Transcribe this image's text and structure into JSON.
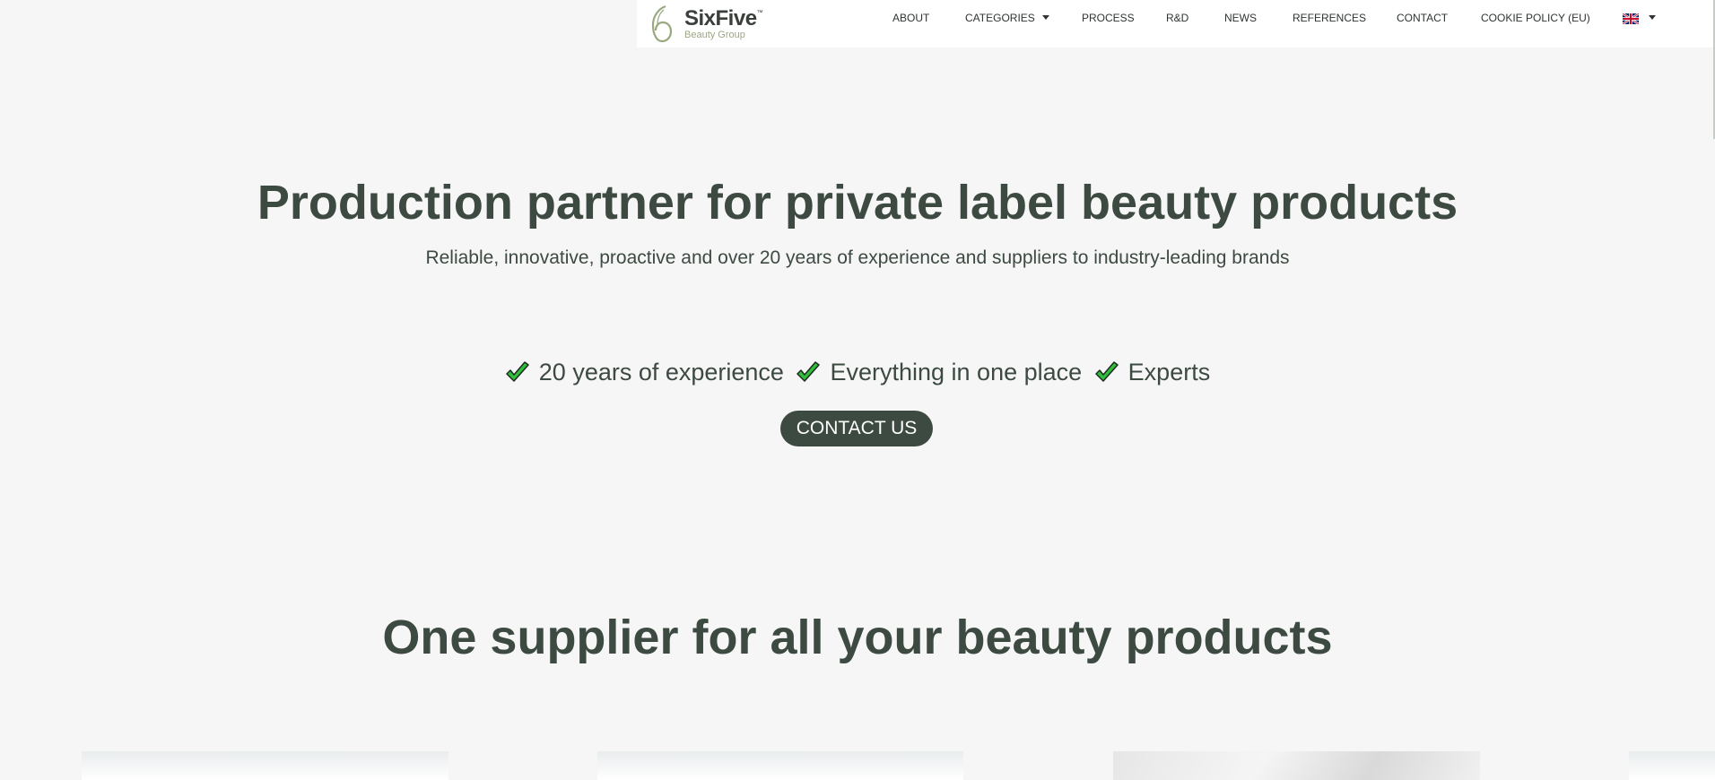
{
  "header": {
    "logo": {
      "name": "SixFive",
      "tm": "™",
      "subtitle": "Beauty Group"
    },
    "nav": [
      {
        "label": "ABOUT"
      },
      {
        "label": "CATEGORIES"
      },
      {
        "label": "PROCESS"
      },
      {
        "label": "R&D"
      },
      {
        "label": "NEWS"
      },
      {
        "label": "REFERENCES"
      },
      {
        "label": "CONTACT"
      },
      {
        "label": "COOKIE POLICY (EU)"
      }
    ],
    "language_icon": "uk-flag-icon"
  },
  "hero": {
    "title": "Production partner for private label beauty products",
    "subtitle": "Reliable, innovative, proactive and over 20 years of experience and suppliers to industry-leading brands",
    "benefits": [
      "20 years of experience",
      "Everything in one place",
      "Experts"
    ],
    "check_icon": "check-icon",
    "cta": "CONTACT US"
  },
  "products": {
    "title": "One supplier for all your beauty products"
  },
  "colors": {
    "background": "#f6f6f6",
    "primary": "#3d4a42",
    "check": "#2fbf3a",
    "logo_accent": "#9aa87f"
  }
}
